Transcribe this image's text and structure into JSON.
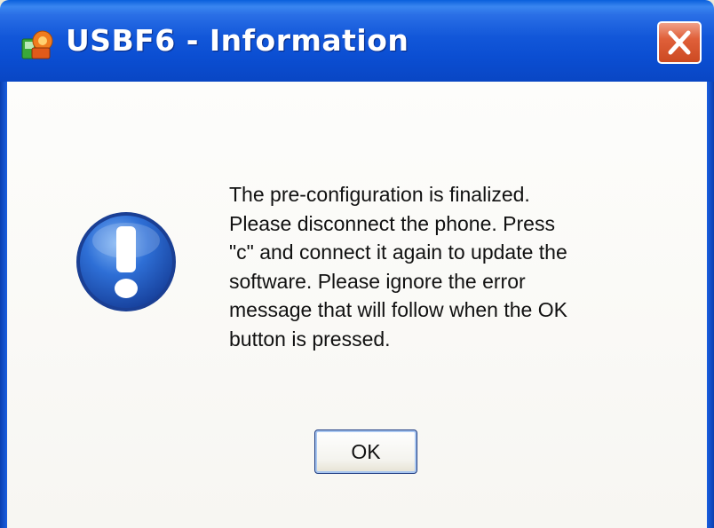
{
  "window": {
    "title": "USBF6 - Information",
    "title_icon": "application-icon",
    "close_icon": "close-icon"
  },
  "dialog": {
    "icon": "exclamation-info-icon",
    "message_lines": [
      "The pre-configuration is finalized.",
      "Please disconnect the phone. Press",
      "\"c\" and connect it again to update the",
      "software. Please ignore the error",
      "message that will follow when the OK",
      "button is pressed."
    ],
    "ok_label": "OK"
  },
  "colors": {
    "titlebar": "#0b4ed2",
    "close_button": "#e0603a",
    "info_icon": "#1f5fbf"
  }
}
